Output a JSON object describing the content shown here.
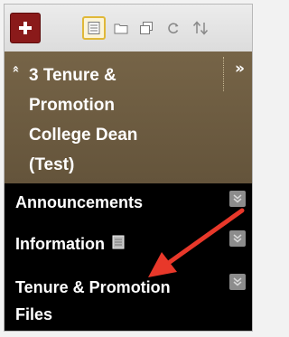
{
  "toolbar": {
    "add_icon": "plus-icon",
    "tools": [
      "list-view-icon",
      "folder-icon",
      "windows-icon",
      "refresh-icon",
      "sort-icon"
    ]
  },
  "course": {
    "title_lines": [
      "3 Tenure &",
      "Promotion",
      "College Dean",
      "(Test)"
    ],
    "collapse_icon_glyph": "«",
    "expand_icon_glyph": "»"
  },
  "menu": {
    "items": [
      {
        "label_lines": [
          "Announcements"
        ]
      },
      {
        "label_lines": [
          "Information"
        ]
      },
      {
        "label_lines": [
          "Tenure & Promotion",
          "Files"
        ]
      }
    ]
  },
  "colors": {
    "add_button": "#8a1a1a",
    "header_brown": "#6e5f44",
    "menu_black": "#000000",
    "annotation_arrow": "#e8382a"
  }
}
